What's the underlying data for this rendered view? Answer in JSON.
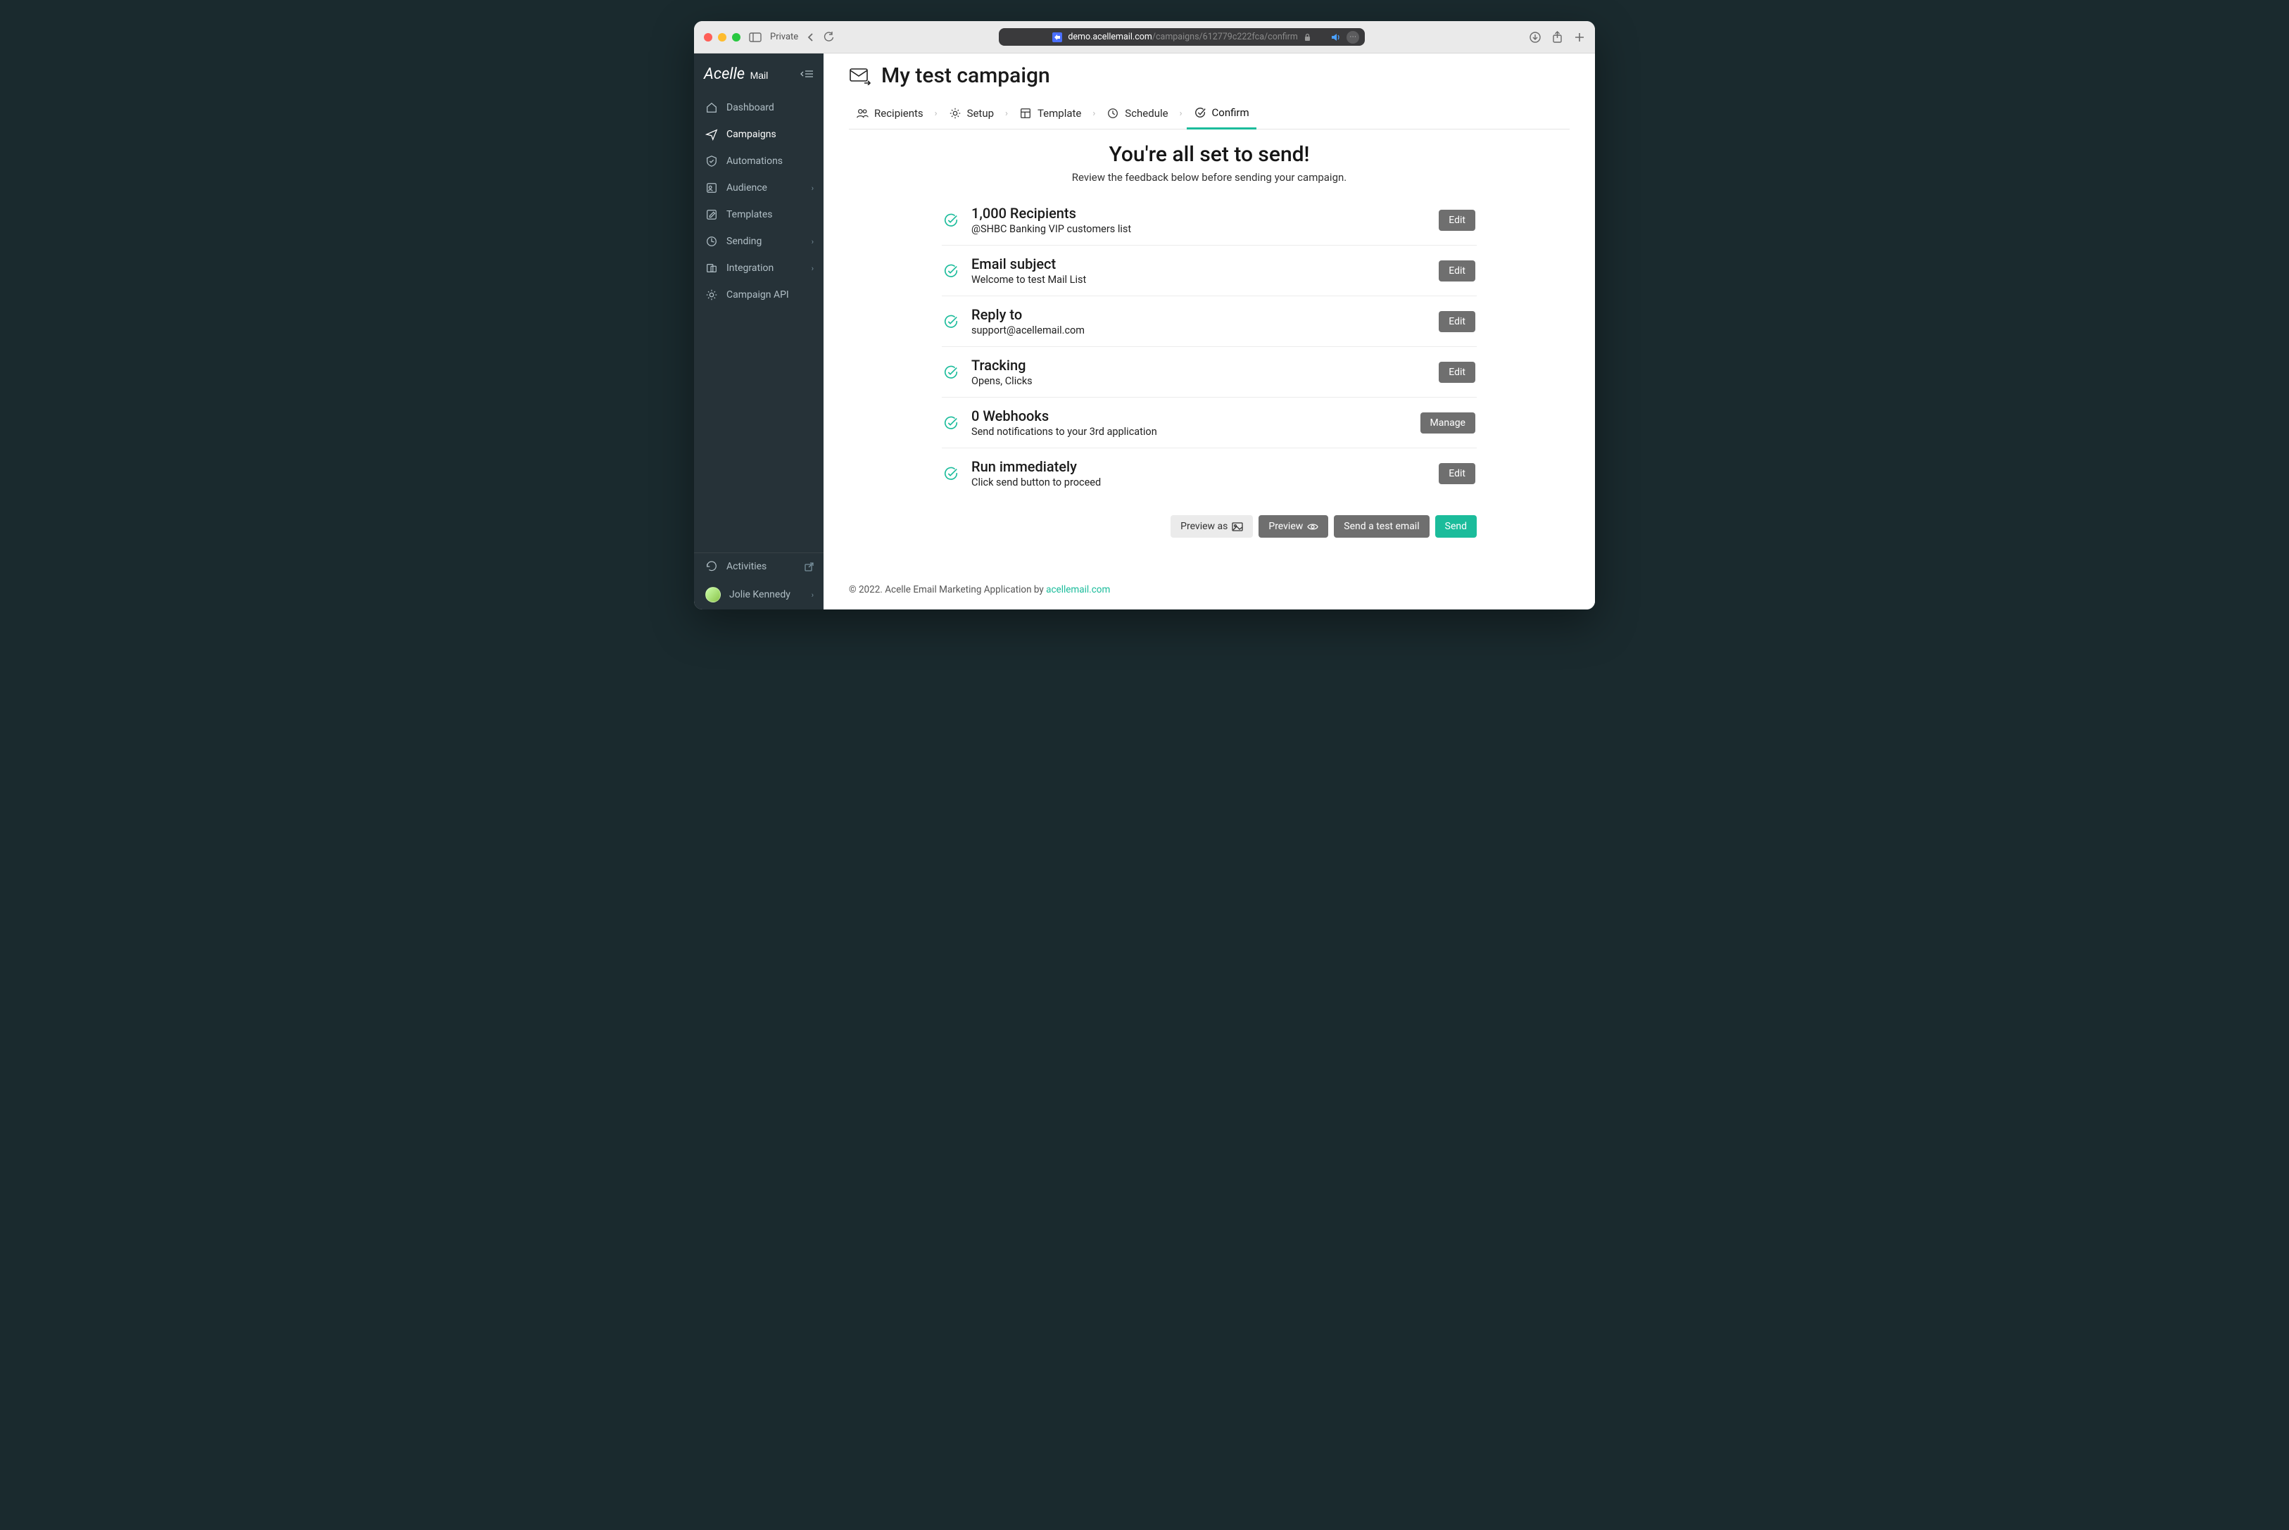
{
  "browser": {
    "private_label": "Private",
    "url_prefix": "demo.acellemail.com",
    "url_suffix": "/campaigns/612779c222fca/confirm"
  },
  "sidebar": {
    "brand": "Acelle",
    "brand_sub": "Mail",
    "items": [
      {
        "label": "Dashboard"
      },
      {
        "label": "Campaigns"
      },
      {
        "label": "Automations"
      },
      {
        "label": "Audience",
        "chev": true
      },
      {
        "label": "Templates"
      },
      {
        "label": "Sending",
        "chev": true
      },
      {
        "label": "Integration",
        "chev": true
      },
      {
        "label": "Campaign API"
      }
    ],
    "activities_label": "Activities",
    "user_name": "Jolie Kennedy"
  },
  "page": {
    "title": "My test campaign",
    "steps": [
      {
        "label": "Recipients"
      },
      {
        "label": "Setup"
      },
      {
        "label": "Template"
      },
      {
        "label": "Schedule"
      },
      {
        "label": "Confirm"
      }
    ],
    "headline": "You're all set to send!",
    "sub": "Review the feedback below before sending your campaign.",
    "items": [
      {
        "title": "1,000 Recipients",
        "desc": "@SHBC Banking VIP customers list",
        "btn": "Edit"
      },
      {
        "title": "Email subject",
        "desc": "Welcome to test Mail List",
        "btn": "Edit"
      },
      {
        "title": "Reply to",
        "desc": "support@acellemail.com",
        "btn": "Edit"
      },
      {
        "title": "Tracking",
        "desc": "Opens, Clicks",
        "btn": "Edit"
      },
      {
        "title": "0 Webhooks",
        "desc": "Send notifications to your 3rd application",
        "btn": "Manage"
      },
      {
        "title": "Run immediately",
        "desc": "Click send button to proceed",
        "btn": "Edit"
      }
    ],
    "actions": {
      "preview_as": "Preview as",
      "preview": "Preview",
      "test": "Send a test email",
      "send": "Send"
    },
    "footer_prefix": "© 2022. Acelle Email Marketing Application by ",
    "footer_link": "acellemail.com"
  }
}
